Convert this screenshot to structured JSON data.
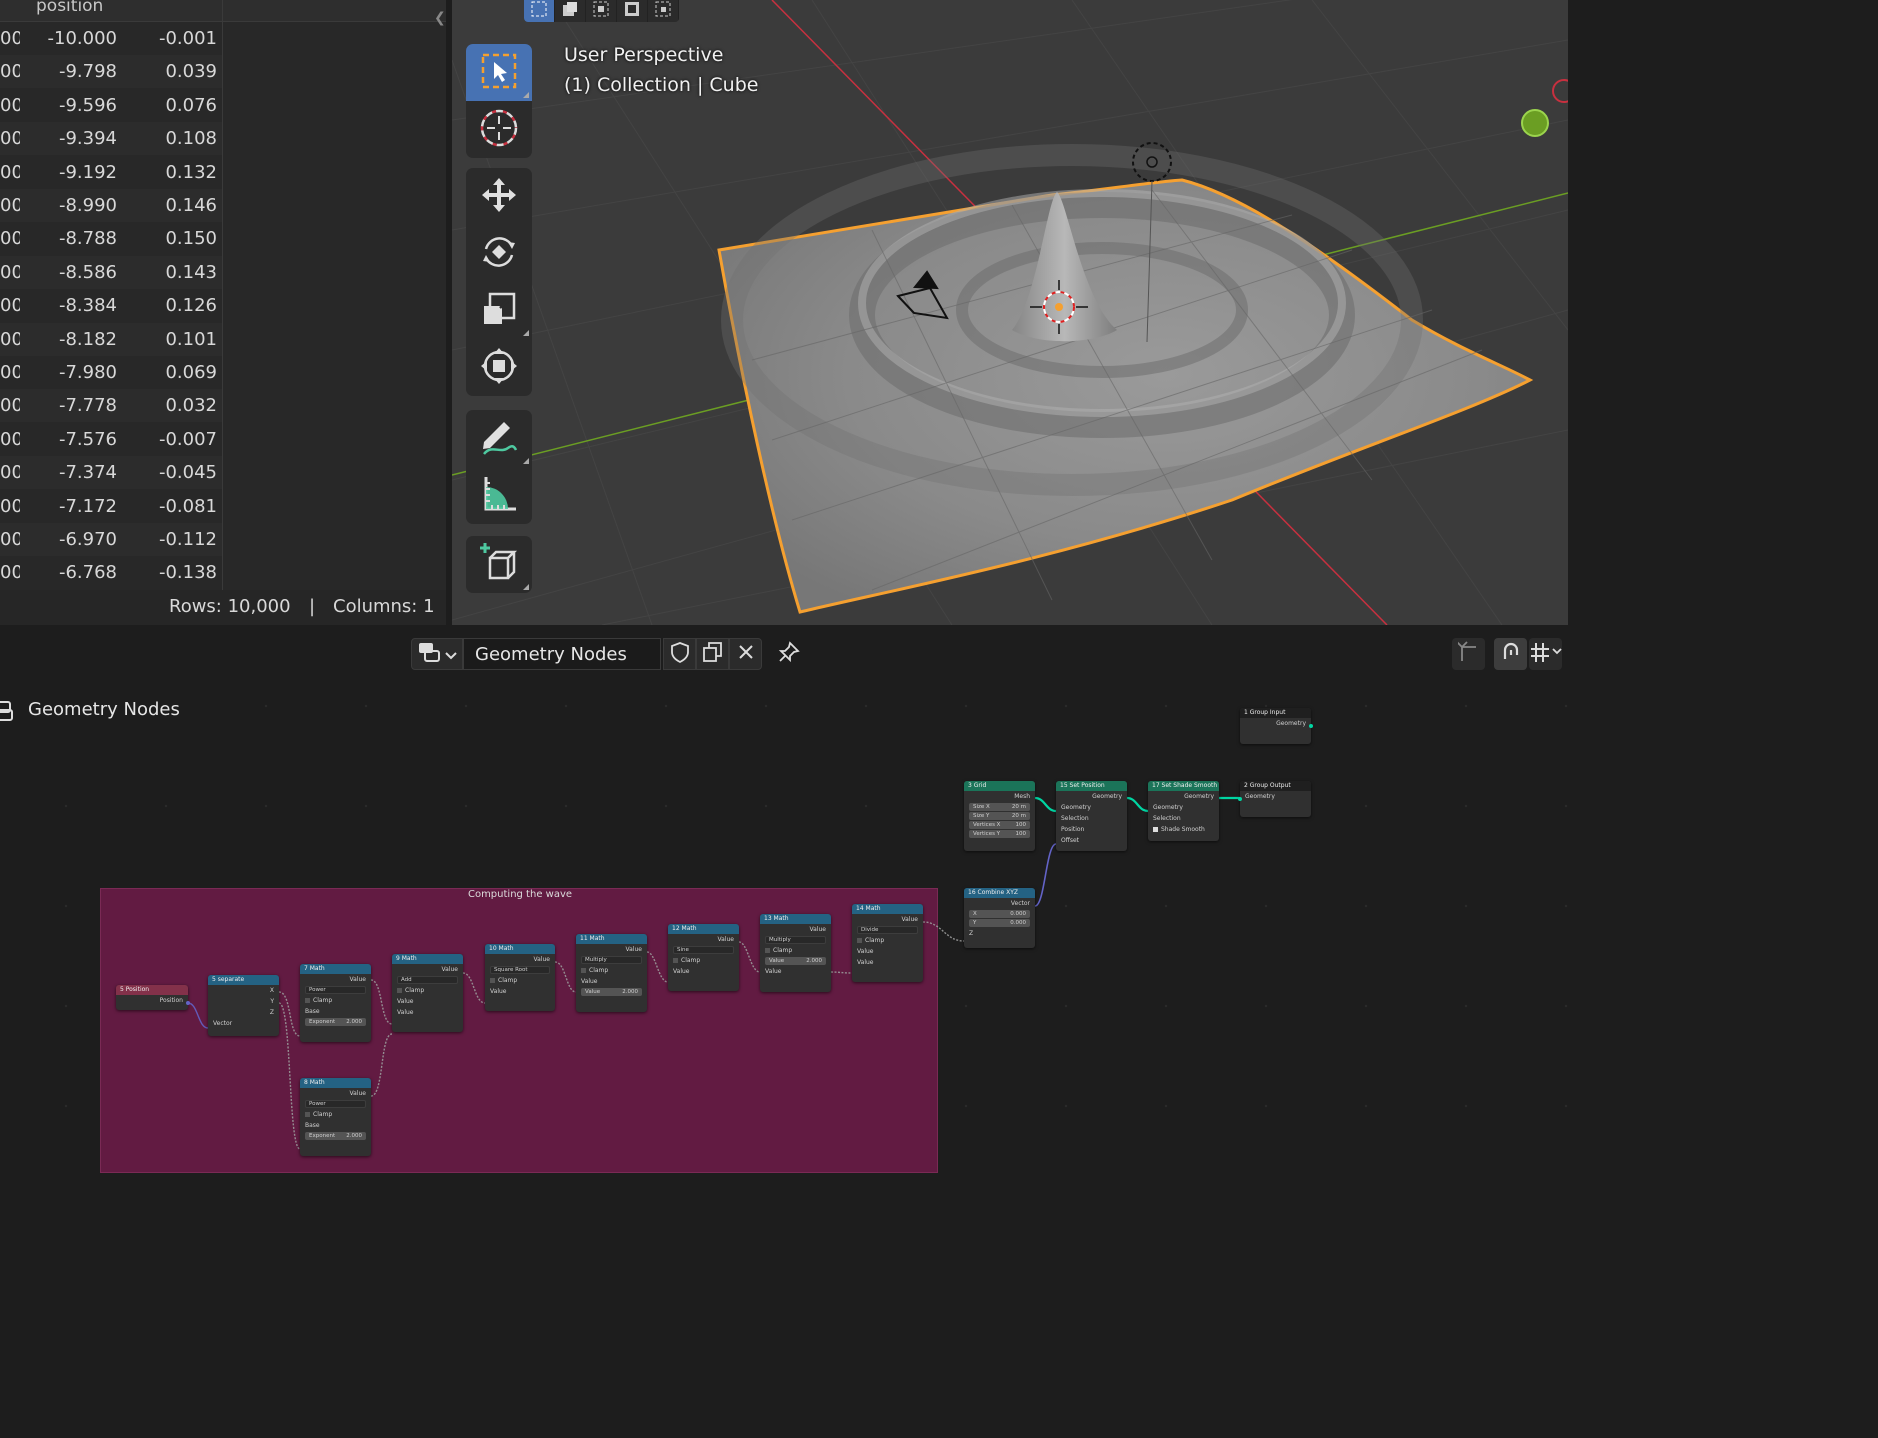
{
  "spreadsheet": {
    "column_title": "position",
    "rows": [
      [
        "00",
        "-10.000",
        "-0.001"
      ],
      [
        "00",
        "-9.798",
        "0.039"
      ],
      [
        "00",
        "-9.596",
        "0.076"
      ],
      [
        "00",
        "-9.394",
        "0.108"
      ],
      [
        "00",
        "-9.192",
        "0.132"
      ],
      [
        "00",
        "-8.990",
        "0.146"
      ],
      [
        "00",
        "-8.788",
        "0.150"
      ],
      [
        "00",
        "-8.586",
        "0.143"
      ],
      [
        "00",
        "-8.384",
        "0.126"
      ],
      [
        "00",
        "-8.182",
        "0.101"
      ],
      [
        "00",
        "-7.980",
        "0.069"
      ],
      [
        "00",
        "-7.778",
        "0.032"
      ],
      [
        "00",
        "-7.576",
        "-0.007"
      ],
      [
        "00",
        "-7.374",
        "-0.045"
      ],
      [
        "00",
        "-7.172",
        "-0.081"
      ],
      [
        "00",
        "-6.970",
        "-0.112"
      ],
      [
        "00",
        "-6.768",
        "-0.138"
      ]
    ],
    "footer": {
      "rows": "Rows: 10,000",
      "sep": "|",
      "columns": "Columns: 1"
    }
  },
  "viewport": {
    "line1": "User Perspective",
    "line2": "(1) Collection | Cube",
    "colors": {
      "selection": "#f5a030",
      "x_axis": "#c8303f",
      "y_axis": "#6b9e23",
      "active_tool": "#4772b3"
    },
    "tools": [
      "select-box-icon",
      "cursor-icon",
      "move-icon",
      "rotate-icon",
      "scale-icon",
      "transform-icon",
      "annotate-icon",
      "measure-icon",
      "add-cube-icon"
    ]
  },
  "node_editor": {
    "tree_name": "Geometry Nodes",
    "breadcrumb": "Geometry Nodes",
    "frame_label": "Computing the wave",
    "nodes": {
      "position": {
        "title": "5 Position",
        "out": "Position"
      },
      "separate": {
        "title": "5 separate",
        "x": "X",
        "y": "Y",
        "z": "Z",
        "in": "Vector"
      },
      "math7": {
        "title": "7 Math",
        "out": "Value",
        "op": "Power",
        "clamp": "Clamp",
        "base": "Base",
        "exp_label": "Exponent",
        "exp_val": "2.000"
      },
      "math8": {
        "title": "8 Math",
        "out": "Value",
        "op": "Power",
        "clamp": "Clamp",
        "base": "Base",
        "exp_label": "Exponent",
        "exp_val": "2.000"
      },
      "math9": {
        "title": "9 Math",
        "out": "Value",
        "op": "Add",
        "clamp": "Clamp",
        "in1": "Value",
        "in2": "Value"
      },
      "math10": {
        "title": "10 Math",
        "out": "Value",
        "op": "Square Root",
        "clamp": "Clamp",
        "in1": "Value"
      },
      "math11": {
        "title": "11 Math",
        "out": "Value",
        "op": "Multiply",
        "clamp": "Clamp",
        "in1": "Value",
        "in2": "Value",
        "in2_val": "2.000"
      },
      "math12": {
        "title": "12 Math",
        "out": "Value",
        "op": "Sine",
        "clamp": "Clamp",
        "in1": "Value"
      },
      "math13": {
        "title": "13 Math",
        "out": "Value",
        "op": "Multiply",
        "clamp": "Clamp",
        "in1": "Value",
        "in2": "Value",
        "in2_val": "2.000"
      },
      "math14": {
        "title": "14 Math",
        "out": "Value",
        "op": "Divide",
        "clamp": "Clamp",
        "in1": "Value",
        "in2": "Value"
      },
      "grid": {
        "title": "3 Grid",
        "out": "Mesh",
        "sx": "Size X",
        "sx_v": "20 m",
        "sy": "Size Y",
        "sy_v": "20 m",
        "vx": "Vertices X",
        "vx_v": "100",
        "vy": "Vertices Y",
        "vy_v": "100"
      },
      "setpos": {
        "title": "15 Set Position",
        "out": "Geometry",
        "geo": "Geometry",
        "sel": "Selection",
        "pos": "Position",
        "off": "Offset"
      },
      "smooth": {
        "title": "17 Set Shade Smooth",
        "out": "Geometry",
        "geo": "Geometry",
        "sel": "Selection",
        "ss": "Shade Smooth"
      },
      "ginput": {
        "title": "1 Group Input",
        "out": "Geometry"
      },
      "goutput": {
        "title": "2 Group Output",
        "in": "Geometry"
      },
      "combine": {
        "title": "16 Combine XYZ",
        "out": "Vector",
        "x": "X",
        "x_v": "0.000",
        "y": "Y",
        "y_v": "0.000",
        "z": "Z"
      }
    }
  }
}
